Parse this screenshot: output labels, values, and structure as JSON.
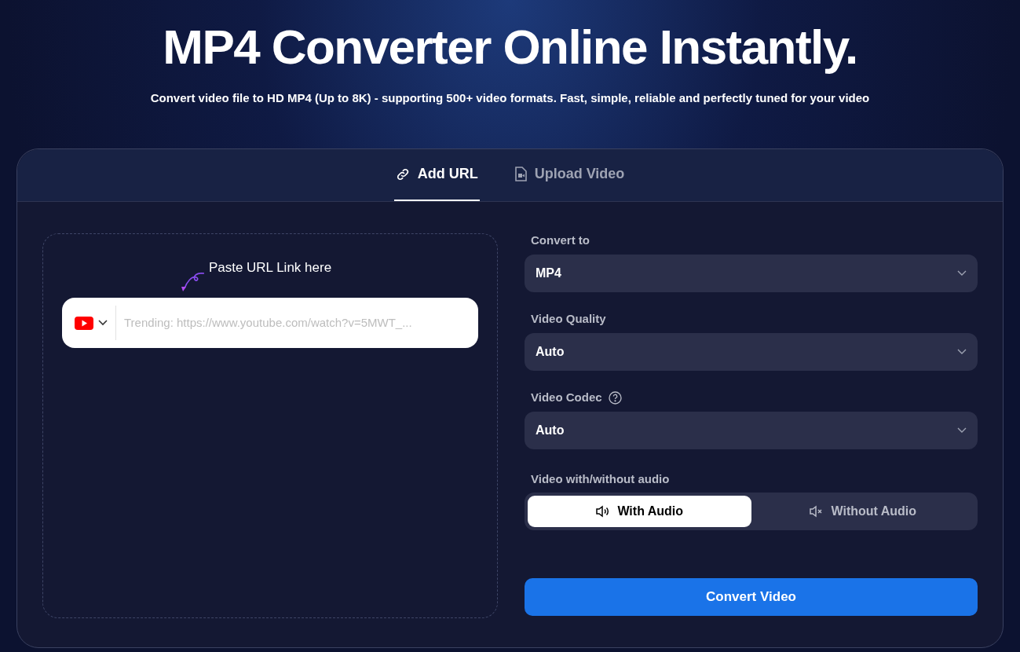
{
  "hero": {
    "title": "MP4 Converter Online Instantly.",
    "subtitle": "Convert video file to HD MP4 (Up to 8K) - supporting 500+ video formats. Fast, simple, reliable and perfectly tuned for your video"
  },
  "tabs": [
    {
      "label": "Add URL",
      "kind": "link",
      "selected": true
    },
    {
      "label": "Upload Video",
      "kind": "file",
      "selected": false
    }
  ],
  "url_panel": {
    "hint": "Paste URL Link here",
    "placeholder": "Trending: https://www.youtube.com/watch?v=5MWT_..."
  },
  "settings": [
    {
      "label": "Convert to",
      "value": "MP4",
      "help": false
    },
    {
      "label": "Video Quality",
      "value": "Auto",
      "help": false
    },
    {
      "label": "Video Codec",
      "value": "Auto",
      "help": true
    }
  ],
  "audio": {
    "label": "Video with/without audio",
    "options": [
      {
        "label": "With Audio",
        "kind": "sound",
        "selected": true
      },
      {
        "label": "Without Audio",
        "kind": "mute",
        "selected": false
      }
    ]
  },
  "convert_button": "Convert Video"
}
